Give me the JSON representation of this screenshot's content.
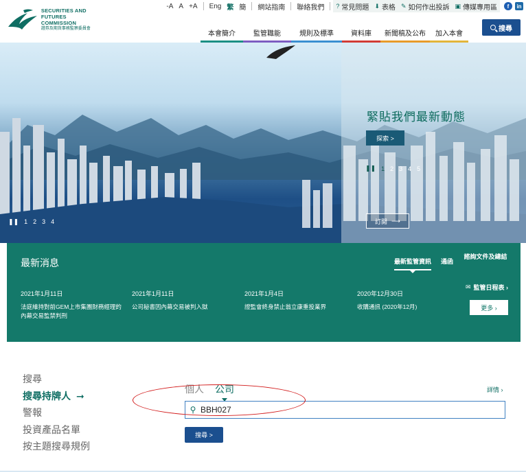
{
  "header": {
    "logo_en_line1": "SECURITIES AND",
    "logo_en_line2": "FUTURES COMMISSION",
    "logo_zh": "證券及期貨事務監察委員會",
    "font_small": "-A",
    "font_medium": "A",
    "font_large": "+A",
    "lang_en": "Eng",
    "lang_tc": "繁",
    "lang_sc": "簡",
    "sitemap": "網站指南",
    "contact": "聯絡我們",
    "faq": "常見問題",
    "forms": "表格",
    "complaint": "如何作出投訴",
    "media": "傳媒專用區",
    "search_label": "搜尋",
    "nav": [
      {
        "label": "本會簡介",
        "color": "#1b8f84"
      },
      {
        "label": "監管職能",
        "color": "#7d5cc1"
      },
      {
        "label": "規則及標準",
        "color": "#3a8fd1"
      },
      {
        "label": "資料庫",
        "color": "#d23b35"
      },
      {
        "label": "新聞稿及公布",
        "color": "#e89b2a"
      },
      {
        "label": "加入本會",
        "color": "#e3b53a"
      }
    ]
  },
  "hero": {
    "title": "緊貼我們最新動態",
    "explore_label": "探索 >",
    "pages": [
      "1",
      "2",
      "3",
      "4",
      "5"
    ],
    "left_pages": [
      "1",
      "2",
      "3",
      "4"
    ],
    "subscribe_label": "訂閱"
  },
  "news": {
    "title": "最新消息",
    "tabs": [
      "最新監管資訊",
      "通函",
      "諮詢文件及總結"
    ],
    "items": [
      {
        "date": "2021年1月11日",
        "text": "法庭維持對前GEM上市集團財務經理的內幕交易監禁判刑"
      },
      {
        "date": "2021年1月11日",
        "text": "公司秘書因內幕交易被判入獄"
      },
      {
        "date": "2021年1月4日",
        "text": "證監會終身禁止翁立康重投業界"
      },
      {
        "date": "2020年12月30日",
        "text": "收購通訊 (2020年12月)"
      }
    ],
    "calendar_label": "監管日程表 ›",
    "more_label": "更多 ›"
  },
  "search_section": {
    "side_links": [
      "搜尋",
      "搜尋持牌人",
      "警報",
      "投資產品名單",
      "按主題搜尋規例"
    ],
    "active_index": 1,
    "type_individual": "個人",
    "type_corporate": "公司",
    "details_label": "詳情 ›",
    "query_value": "BBH027",
    "submit_label": "搜尋 >"
  }
}
